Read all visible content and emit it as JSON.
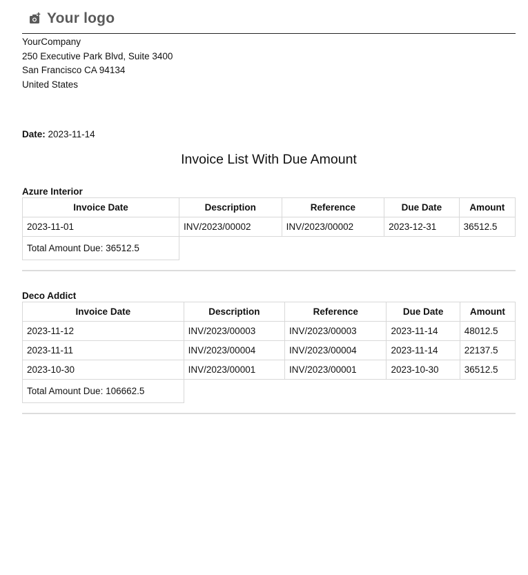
{
  "header": {
    "logo_text": "Your logo",
    "logo_icon": "camera-plus-icon"
  },
  "company": {
    "name": "YourCompany",
    "address_line1": "250 Executive Park Blvd, Suite 3400",
    "address_line2": "San Francisco CA 94134",
    "country": "United States"
  },
  "date": {
    "label": "Date:",
    "value": "2023-11-14"
  },
  "title": "Invoice List With Due Amount",
  "columns": [
    "Invoice Date",
    "Description",
    "Reference",
    "Due Date",
    "Amount"
  ],
  "partners": [
    {
      "name": "Azure Interior",
      "rows": [
        [
          "2023-11-01",
          "INV/2023/00002",
          "INV/2023/00002",
          "2023-12-31",
          "36512.5"
        ]
      ],
      "total_label": "Total Amount Due: 36512.5"
    },
    {
      "name": "Deco Addict",
      "rows": [
        [
          "2023-11-12",
          "INV/2023/00003",
          "INV/2023/00003",
          "2023-11-14",
          "48012.5"
        ],
        [
          "2023-11-11",
          "INV/2023/00004",
          "INV/2023/00004",
          "2023-11-14",
          "22137.5"
        ],
        [
          "2023-10-30",
          "INV/2023/00001",
          "INV/2023/00001",
          "2023-10-30",
          "36512.5"
        ]
      ],
      "total_label": "Total Amount Due: 106662.5"
    }
  ]
}
